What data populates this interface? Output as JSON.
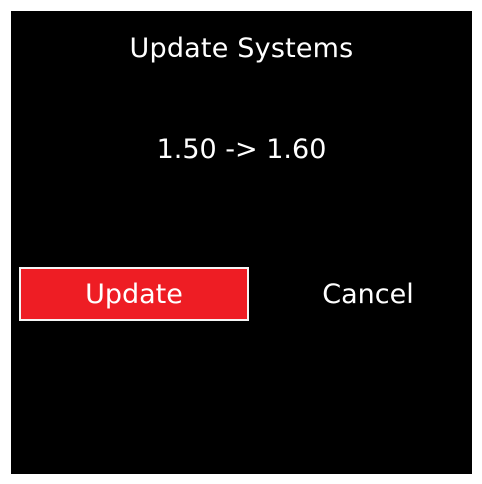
{
  "dialog": {
    "title": "Update Systems",
    "version_change": "1.50 -> 1.60",
    "update_label": "Update",
    "cancel_label": "Cancel"
  },
  "colors": {
    "background": "#000000",
    "accent": "#ee1d24",
    "text": "#ffffff"
  }
}
